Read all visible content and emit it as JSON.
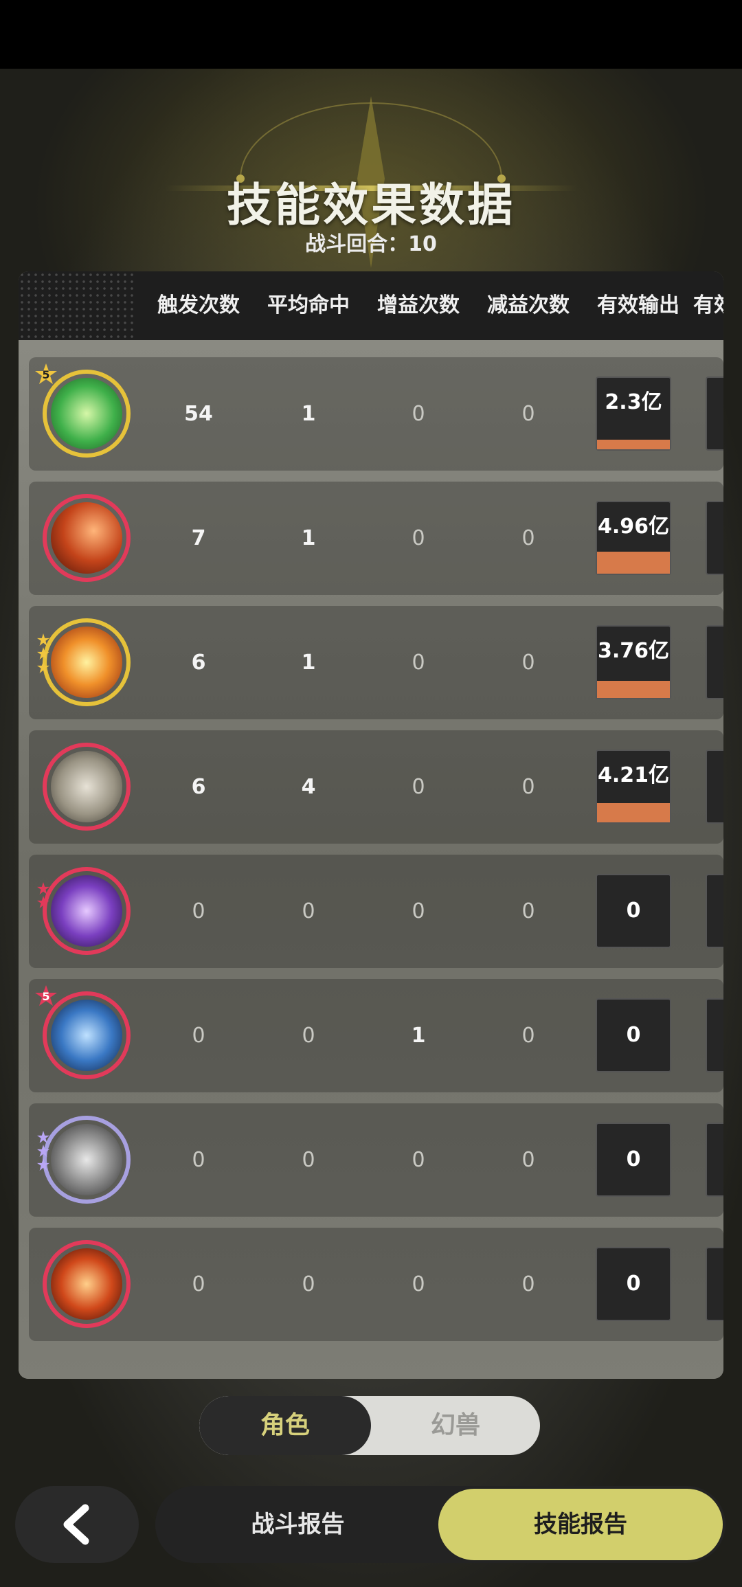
{
  "header": {
    "title": "技能效果数据",
    "subtitle": "战斗回合：10"
  },
  "columns": [
    "触发次数",
    "平均命中",
    "增益次数",
    "减益次数",
    "有效输出",
    "有效"
  ],
  "rows": [
    {
      "icon": "green-vortex-skill-icon",
      "badge": "5",
      "trigger": "54",
      "hit": "1",
      "buff": "0",
      "debuff": "0",
      "output": "2.3亿",
      "output_fraction": 0.13
    },
    {
      "icon": "flame-claw-skill-icon",
      "badge": "",
      "trigger": "7",
      "hit": "1",
      "buff": "0",
      "debuff": "0",
      "output": "4.96亿",
      "output_fraction": 0.31
    },
    {
      "icon": "explosion-skill-icon",
      "badge": "",
      "trigger": "6",
      "hit": "1",
      "buff": "0",
      "debuff": "0",
      "output": "3.76亿",
      "output_fraction": 0.24
    },
    {
      "icon": "blade-strike-skill-icon",
      "badge": "",
      "trigger": "6",
      "hit": "4",
      "buff": "0",
      "debuff": "0",
      "output": "4.21亿",
      "output_fraction": 0.27
    },
    {
      "icon": "purple-orb-skill-icon",
      "badge": "",
      "trigger": "0",
      "hit": "0",
      "buff": "0",
      "debuff": "0",
      "output": "0",
      "output_fraction": 0
    },
    {
      "icon": "blue-crest-skill-icon",
      "badge": "5",
      "trigger": "0",
      "hit": "0",
      "buff": "1",
      "debuff": "0",
      "output": "0",
      "output_fraction": 0
    },
    {
      "icon": "silhouette-strike-skill-icon",
      "badge": "",
      "trigger": "0",
      "hit": "0",
      "buff": "0",
      "debuff": "0",
      "output": "0",
      "output_fraction": 0
    },
    {
      "icon": "fire-figure-skill-icon",
      "badge": "",
      "trigger": "0",
      "hit": "0",
      "buff": "0",
      "debuff": "0",
      "output": "0",
      "output_fraction": 0
    }
  ],
  "toggle": {
    "left": "角色",
    "right": "幻兽"
  },
  "bottom": {
    "tab_battle": "战斗报告",
    "tab_skill": "技能报告"
  },
  "colors": {
    "accent": "#d2cf6c",
    "output_bar": "#d77a4a",
    "ring_red": "#e23a5a",
    "ring_gold": "#e6c23a"
  }
}
